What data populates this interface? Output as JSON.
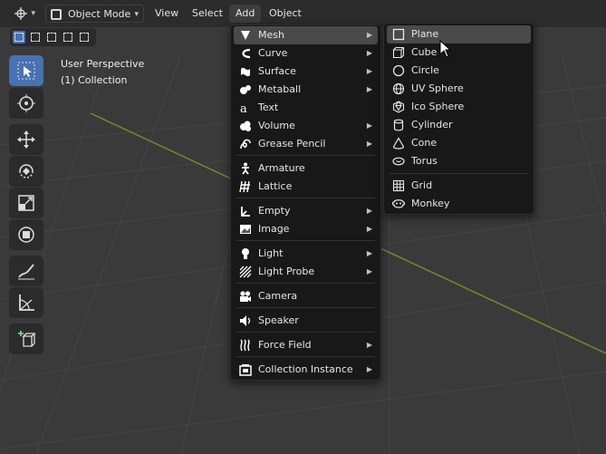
{
  "header": {
    "editor_type_icon": "3d-viewport-icon",
    "mode_label": "Object Mode",
    "menus": [
      {
        "label": "View"
      },
      {
        "label": "Select"
      },
      {
        "label": "Add",
        "active": true
      },
      {
        "label": "Object"
      }
    ]
  },
  "viewport": {
    "perspective": "User Perspective",
    "collection": "(1) Collection"
  },
  "select_modes": [
    "set",
    "extend",
    "subtract",
    "difference",
    "intersect"
  ],
  "tools": [
    "select-box",
    "cursor",
    "move",
    "rotate",
    "scale",
    "transform",
    "annotate",
    "measure",
    "add-cube"
  ],
  "add_menu": {
    "items": [
      {
        "label": "Mesh",
        "icon": "mesh-icon",
        "submenu": true,
        "highlighted": true
      },
      {
        "label": "Curve",
        "icon": "curve-icon",
        "submenu": true
      },
      {
        "label": "Surface",
        "icon": "surface-icon",
        "submenu": true
      },
      {
        "label": "Metaball",
        "icon": "metaball-icon",
        "submenu": true
      },
      {
        "label": "Text",
        "icon": "text-icon",
        "submenu": false
      },
      {
        "label": "Volume",
        "icon": "volume-icon",
        "submenu": true
      },
      {
        "label": "Grease Pencil",
        "icon": "grease-pencil-icon",
        "submenu": true
      },
      {
        "label": "Armature",
        "icon": "armature-icon",
        "submenu": false
      },
      {
        "label": "Lattice",
        "icon": "lattice-icon",
        "submenu": false
      },
      {
        "label": "Empty",
        "icon": "empty-icon",
        "submenu": true
      },
      {
        "label": "Image",
        "icon": "image-icon",
        "submenu": true
      },
      {
        "label": "Light",
        "icon": "light-icon",
        "submenu": true
      },
      {
        "label": "Light Probe",
        "icon": "light-probe-icon",
        "submenu": true
      },
      {
        "label": "Camera",
        "icon": "camera-icon",
        "submenu": false
      },
      {
        "label": "Speaker",
        "icon": "speaker-icon",
        "submenu": false
      },
      {
        "label": "Force Field",
        "icon": "force-field-icon",
        "submenu": true
      },
      {
        "label": "Collection Instance",
        "icon": "collection-instance-icon",
        "submenu": true
      }
    ]
  },
  "mesh_menu": {
    "items": [
      {
        "label": "Plane",
        "icon": "plane-icon",
        "highlighted": true
      },
      {
        "label": "Cube",
        "icon": "cube-icon"
      },
      {
        "label": "Circle",
        "icon": "circle-icon"
      },
      {
        "label": "UV Sphere",
        "icon": "uv-sphere-icon"
      },
      {
        "label": "Ico Sphere",
        "icon": "ico-sphere-icon"
      },
      {
        "label": "Cylinder",
        "icon": "cylinder-icon"
      },
      {
        "label": "Cone",
        "icon": "cone-icon"
      },
      {
        "label": "Torus",
        "icon": "torus-icon"
      },
      {
        "label": "Grid",
        "icon": "grid-icon"
      },
      {
        "label": "Monkey",
        "icon": "monkey-icon"
      }
    ]
  },
  "colors": {
    "accent": "#4772b3",
    "menu_bg": "#181818",
    "highlight": "#4a4a4a",
    "viewport_bg": "#3a3a3a",
    "grid_line": "#444444",
    "axis_green": "#6b8f2a"
  }
}
